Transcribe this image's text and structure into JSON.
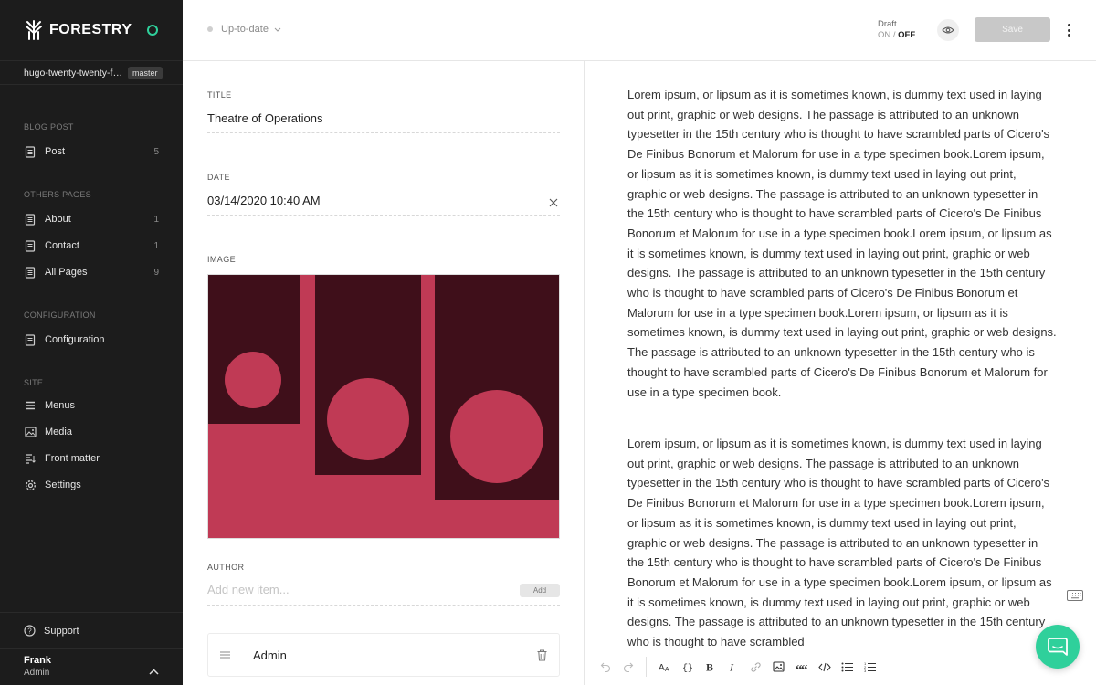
{
  "app": {
    "brand": "FORESTRY"
  },
  "repo": {
    "name": "hugo-twenty-twenty-f…",
    "branch": "master"
  },
  "sidebar": {
    "sections": [
      {
        "title": "BLOG POST"
      },
      {
        "title": "OTHERS PAGES"
      },
      {
        "title": "CONFIGURATION"
      },
      {
        "title": "SITE"
      }
    ],
    "items": [
      {
        "label": "Post",
        "count": "5",
        "icon": "file-icon"
      },
      {
        "label": "About",
        "count": "1",
        "icon": "file-icon"
      },
      {
        "label": "Contact",
        "count": "1",
        "icon": "file-icon"
      },
      {
        "label": "All Pages",
        "count": "9",
        "icon": "file-icon"
      },
      {
        "label": "Configuration",
        "count": "",
        "icon": "file-icon"
      },
      {
        "label": "Menus",
        "count": "",
        "icon": "menu-icon"
      },
      {
        "label": "Media",
        "count": "",
        "icon": "image-icon"
      },
      {
        "label": "Front matter",
        "count": "",
        "icon": "front-matter-icon"
      },
      {
        "label": "Settings",
        "count": "",
        "icon": "gear-icon"
      }
    ],
    "support": "Support",
    "user": {
      "name": "Frank",
      "role": "Admin"
    }
  },
  "topbar": {
    "status": "Up-to-date",
    "draft_label": "Draft",
    "draft_on": "ON",
    "draft_sep": "/",
    "draft_off": "OFF",
    "save": "Save"
  },
  "form": {
    "title_label": "TITLE",
    "title_value": "Theatre of Operations",
    "date_label": "DATE",
    "date_value": "03/14/2020 10:40 AM",
    "image_label": "IMAGE",
    "author_label": "AUTHOR",
    "author_placeholder": "Add new item...",
    "add_button": "Add",
    "authors": [
      "Admin"
    ]
  },
  "content": {
    "paragraphs": [
      "Lorem ipsum, or lipsum as it is sometimes known, is dummy text used in laying out print, graphic or web designs. The passage is attributed to an unknown typesetter in the 15th century who is thought to have scrambled parts of Cicero's De Finibus Bonorum et Malorum for use in a type specimen book.Lorem ipsum, or lipsum as it is sometimes known, is dummy text used in laying out print, graphic or web designs. The passage is attributed to an unknown typesetter in the 15th century who is thought to have scrambled parts of Cicero's De Finibus Bonorum et Malorum for use in a type specimen book.Lorem ipsum, or lipsum as it is sometimes known, is dummy text used in laying out print, graphic or web designs. The passage is attributed to an unknown typesetter in the 15th century who is thought to have scrambled parts of Cicero's De Finibus Bonorum et Malorum for use in a type specimen book.Lorem ipsum, or lipsum as it is sometimes known, is dummy text used in laying out print, graphic or web designs. The passage is attributed to an unknown typesetter in the 15th century who is thought to have scrambled parts of Cicero's De Finibus Bonorum et Malorum for use in a type specimen book.",
      "Lorem ipsum, or lipsum as it is sometimes known, is dummy text used in laying out print, graphic or web designs. The passage is attributed to an unknown typesetter in the 15th century who is thought to have scrambled parts of Cicero's De Finibus Bonorum et Malorum for use in a type specimen book.Lorem ipsum, or lipsum as it is sometimes known, is dummy text used in laying out print, graphic or web designs. The passage is attributed to an unknown typesetter in the 15th century who is thought to have scrambled parts of Cicero's De Finibus Bonorum et Malorum for use in a type specimen book.Lorem ipsum, or lipsum as it is sometimes known, is dummy text used in laying out print, graphic or web designs. The passage is attributed to an unknown typesetter in the 15th century who is thought to have scrambled"
    ]
  },
  "toolbar": {
    "buttons": [
      "undo-icon",
      "redo-icon",
      "text-size-icon",
      "braces-icon",
      "bold-icon",
      "italic-icon",
      "link-icon",
      "image-icon",
      "quote-icon",
      "code-icon",
      "bullet-list-icon",
      "numbered-list-icon"
    ]
  },
  "colors": {
    "sidebar_bg": "#1c1c1c",
    "accent": "#2fd09b",
    "image_dark": "#3f0f1a",
    "image_pink": "#c03a55"
  }
}
